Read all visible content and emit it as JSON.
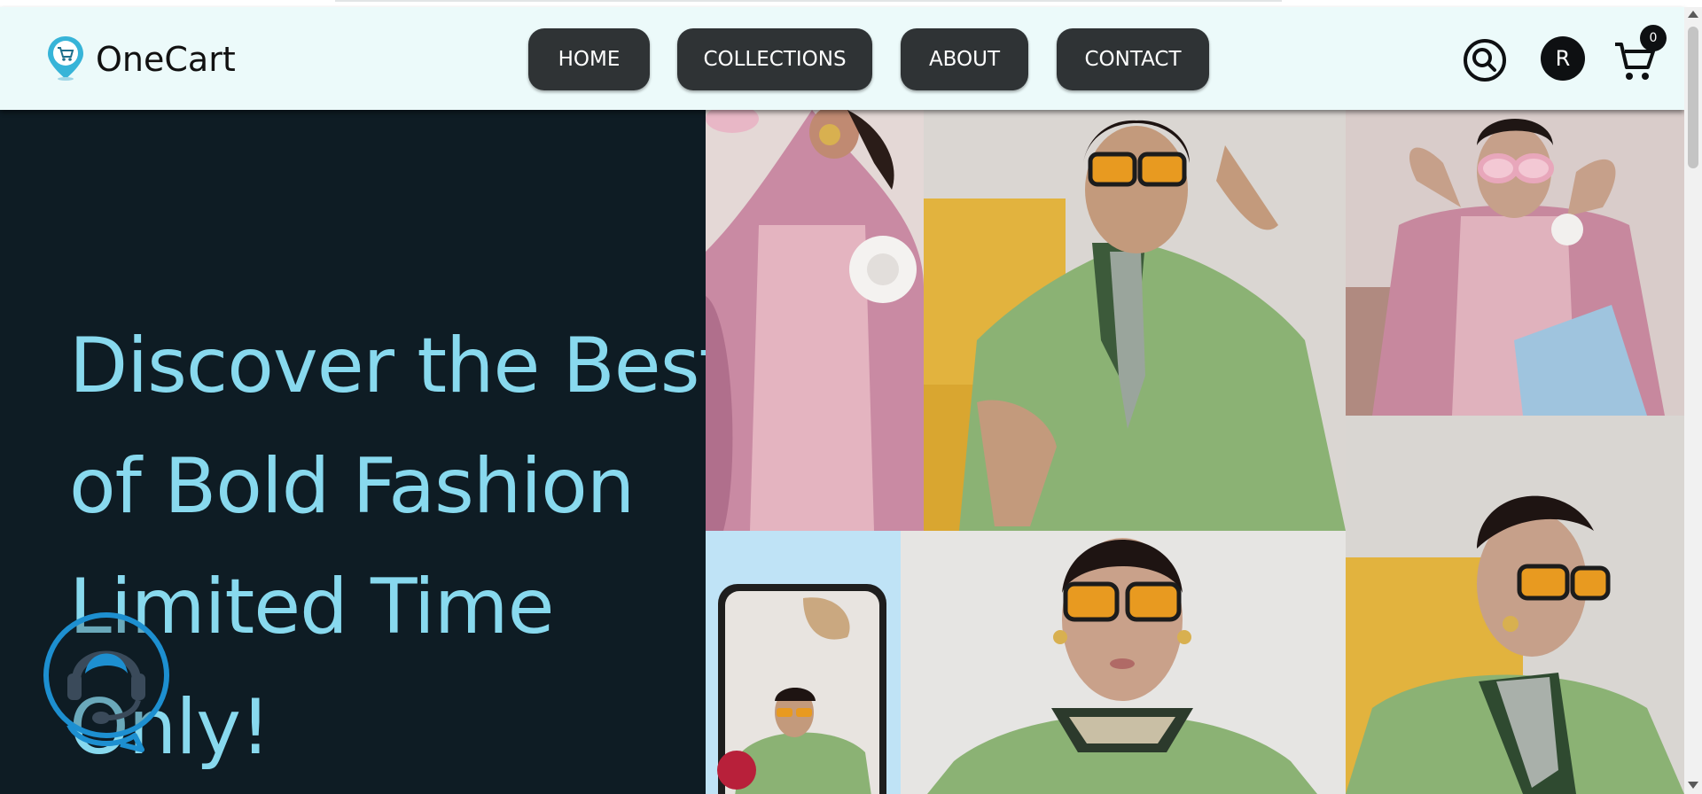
{
  "brand": {
    "name": "OneCart",
    "logo_icon": "cart-location-pin-icon"
  },
  "nav": {
    "items": [
      {
        "label": "HOME"
      },
      {
        "label": "COLLECTIONS"
      },
      {
        "label": "ABOUT"
      },
      {
        "label": "CONTACT"
      }
    ]
  },
  "header_actions": {
    "search_icon": "search-icon",
    "user_initial": "R",
    "cart_icon": "cart-icon",
    "cart_count": "0"
  },
  "hero": {
    "heading_lines": [
      "Discover the Best",
      "of Bold Fashion",
      "Limited Time",
      "Only!"
    ]
  },
  "support_widget": {
    "icon": "customer-support-headset-icon"
  },
  "colors": {
    "navbar_bg": "#ecfafa",
    "nav_button_bg": "#2f3335",
    "hero_bg": "#0e1c24",
    "hero_text": "#88d9ee",
    "support_accent": "#1d8fd0"
  }
}
